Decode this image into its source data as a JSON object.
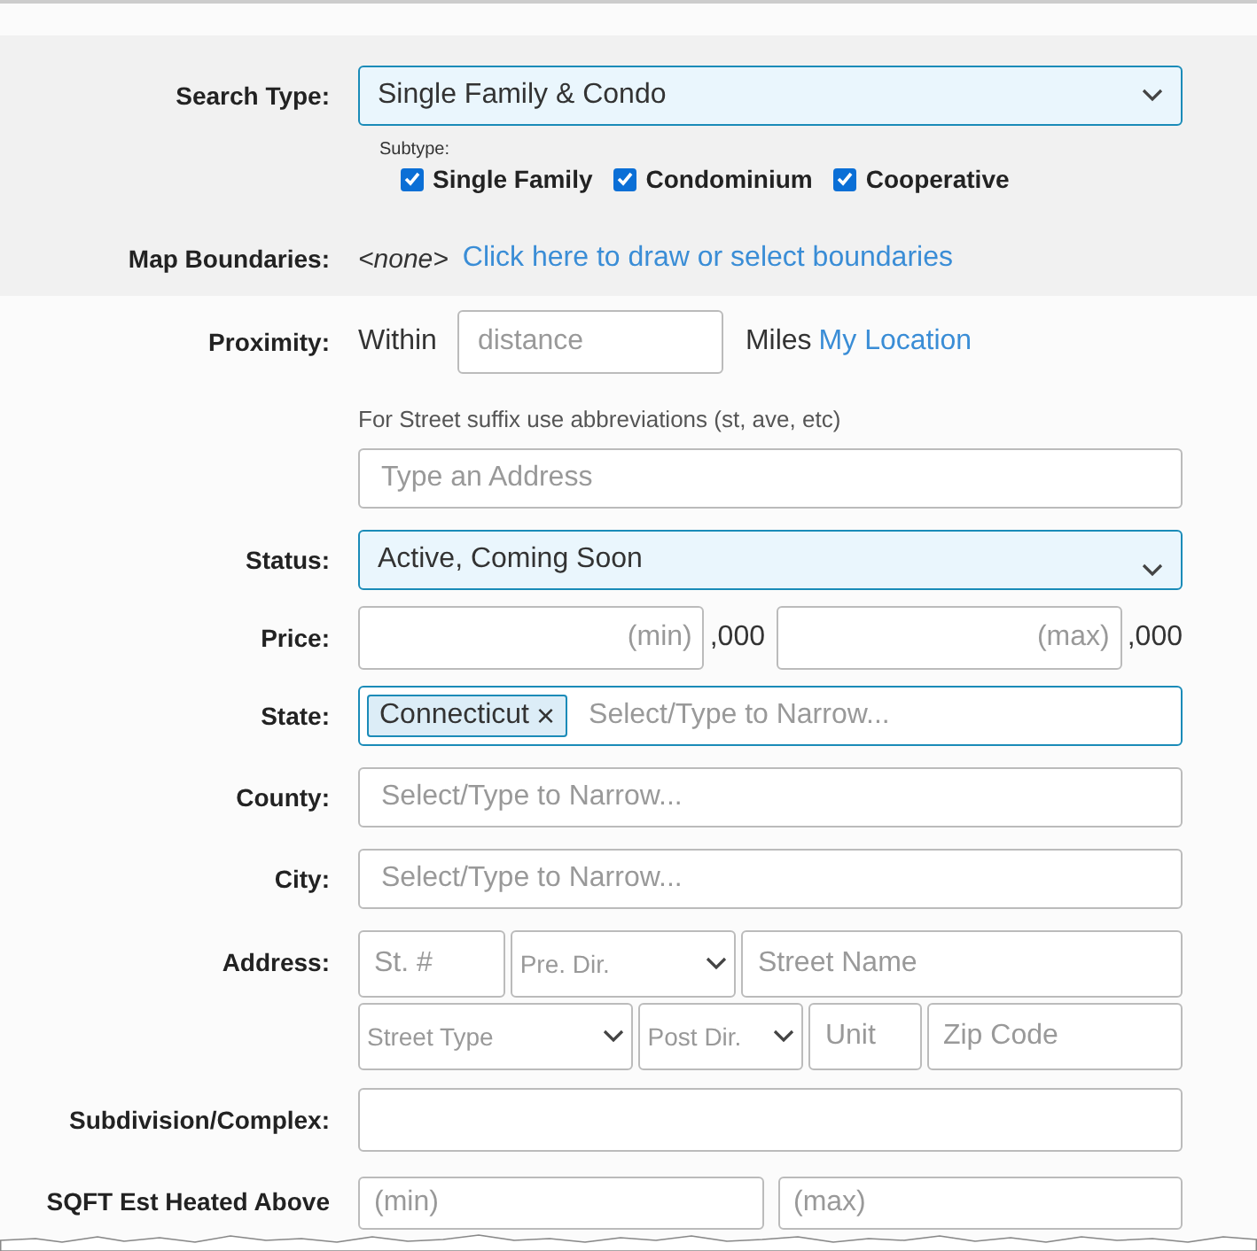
{
  "search_type": {
    "label": "Search Type:",
    "value": "Single Family & Condo",
    "subtype_label": "Subtype:",
    "subtypes": [
      {
        "label": "Single Family",
        "checked": true
      },
      {
        "label": "Condominium",
        "checked": true
      },
      {
        "label": "Cooperative",
        "checked": true
      }
    ]
  },
  "map_boundaries": {
    "label": "Map Boundaries:",
    "value": "<none>",
    "link": "Click here to draw or select boundaries"
  },
  "proximity": {
    "label": "Proximity:",
    "prefix": "Within",
    "placeholder": "distance",
    "unit": "Miles",
    "link": "My Location"
  },
  "hint": "For Street suffix use abbreviations (st, ave, etc)",
  "address_search": {
    "placeholder": "Type an Address"
  },
  "status": {
    "label": "Status:",
    "value": "Active, Coming Soon"
  },
  "price": {
    "label": "Price:",
    "fields": [
      {
        "placeholder": "(min)",
        "suffix": ",000"
      },
      {
        "placeholder": "(max)",
        "suffix": ",000"
      }
    ]
  },
  "state": {
    "label": "State:",
    "tags": [
      {
        "label": "Connecticut",
        "remove": "×"
      }
    ],
    "placeholder": "Select/Type to Narrow..."
  },
  "county": {
    "label": "County:",
    "placeholder": "Select/Type to Narrow..."
  },
  "city": {
    "label": "City:",
    "placeholder": "Select/Type to Narrow..."
  },
  "address": {
    "label": "Address:",
    "rows": [
      [
        {
          "kind": "input",
          "placeholder": "St. #"
        },
        {
          "kind": "select",
          "placeholder": "Pre. Dir."
        },
        {
          "kind": "input",
          "placeholder": "Street Name"
        }
      ],
      [
        {
          "kind": "select",
          "placeholder": "Street Type"
        },
        {
          "kind": "select",
          "placeholder": "Post Dir."
        },
        {
          "kind": "input",
          "placeholder": "Unit"
        },
        {
          "kind": "input",
          "placeholder": "Zip Code"
        }
      ]
    ]
  },
  "subdivision": {
    "label": "Subdivision/Complex:"
  },
  "sqft": {
    "label": "SQFT Est Heated Above",
    "fields": [
      {
        "placeholder": "(min)"
      },
      {
        "placeholder": "(max)"
      }
    ]
  }
}
